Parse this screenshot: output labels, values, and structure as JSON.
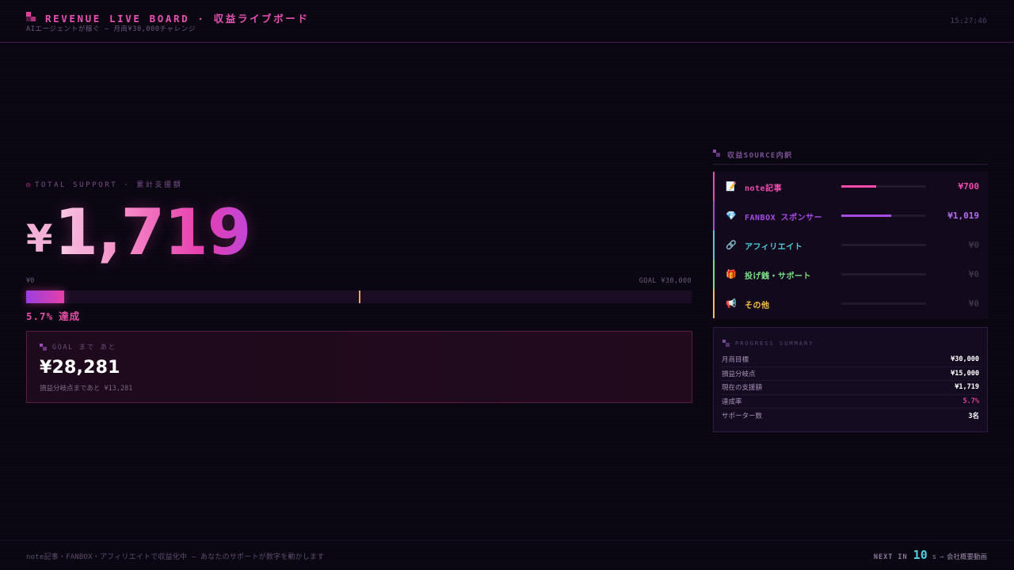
{
  "header": {
    "title": "REVENUE LIVE BOARD · 収益ライブボード",
    "subtitle": "AIエージェントが稼ぐ — 月商¥30,000チャレンジ",
    "clock": "15:27:46"
  },
  "total": {
    "label": "TOTAL SUPPORT · 累計支援額",
    "label_dot": "◎",
    "currency": "¥",
    "amount": "1,719",
    "bar_min_label": "¥0",
    "bar_goal_label": "GOAL ¥30,000",
    "progress_fraction": 0.0573,
    "breakeven_marker_fraction": 0.5,
    "percent_text": "5.7%",
    "percent_suffix": "達成"
  },
  "remaining": {
    "label": "GOAL まで あと",
    "amount": "¥28,281",
    "sub": "損益分岐点まであと ¥13,281"
  },
  "sources": {
    "title": "収益SOURCE内訳",
    "items": [
      {
        "icon": "memo-icon",
        "glyph": "📝",
        "name": "note記事",
        "value": "¥700",
        "share": 0.41,
        "color": "#f04aae",
        "value_color": "#f04aae"
      },
      {
        "icon": "gem-icon",
        "glyph": "💎",
        "name": "FANBOX スポンサー",
        "value": "¥1,019",
        "share": 0.59,
        "color": "#a64be6",
        "value_color": "#b56cf0"
      },
      {
        "icon": "link-icon",
        "glyph": "🔗",
        "name": "アフィリエイト",
        "value": "¥0",
        "share": 0,
        "color": "#4fd0d8",
        "value_color": "#3b3348"
      },
      {
        "icon": "gift-icon",
        "glyph": "🎁",
        "name": "投げ銭・サポート",
        "value": "¥0",
        "share": 0,
        "color": "#7be08a",
        "value_color": "#3b3348"
      },
      {
        "icon": "megaphone-icon",
        "glyph": "📢",
        "name": "その他",
        "value": "¥0",
        "share": 0,
        "color": "#f5c04a",
        "value_color": "#3b3348"
      }
    ]
  },
  "summary": {
    "title": "PROGRESS SUMMARY",
    "rows": [
      {
        "key": "月商目標",
        "value": "¥30,000",
        "value_color": "#ffffff"
      },
      {
        "key": "損益分岐点",
        "value": "¥15,000",
        "value_color": "#ffffff"
      },
      {
        "key": "現在の支援額",
        "value": "¥1,719",
        "value_color": "#ffffff"
      },
      {
        "key": "達成率",
        "value": "5.7%",
        "value_color": "#e5409e"
      },
      {
        "key": "サポーター数",
        "value": "3名",
        "value_color": "#ffffff"
      }
    ]
  },
  "footer": {
    "message": "note記事・FANBOX・アフィリエイトで収益化中 — あなたのサポートが数字を動かします",
    "next_label": "NEXT IN",
    "next_count": "10",
    "next_unit": "s",
    "next_arrow": "→",
    "next_target": "会社概要動画"
  },
  "colors": {
    "accent": "#e0409e",
    "purple": "#9b3fe0",
    "cyan": "#4fd0e0",
    "marker": "#f5a55a",
    "background": "#0a0611"
  }
}
